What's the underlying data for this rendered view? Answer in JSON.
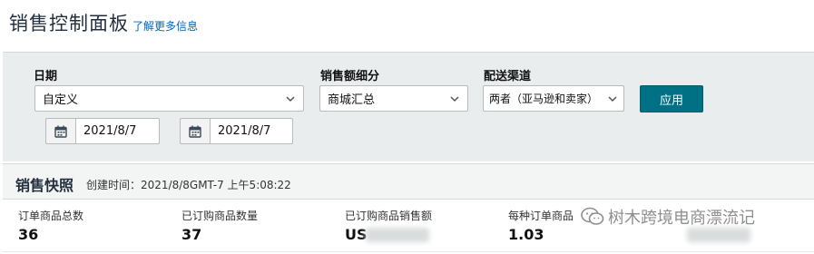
{
  "header": {
    "title": "销售控制面板",
    "info_link": "了解更多信息"
  },
  "filters": {
    "date_label": "日期",
    "date_select_value": "自定义",
    "start_date": "2021/8/7",
    "end_date": "2021/8/7",
    "breakdown_label": "销售额细分",
    "breakdown_value": "商城汇总",
    "channel_label": "配送渠道",
    "channel_value": "两者（亚马逊和卖家）",
    "apply_label": "应用"
  },
  "snapshot": {
    "title": "销售快照",
    "created_time": "创建时间：2021/8/8GMT-7 上午5:08:22",
    "metrics": [
      {
        "label": "订单商品总数",
        "value": "36"
      },
      {
        "label": "已订购商品数量",
        "value": "37"
      },
      {
        "label": "已订购商品销售额",
        "value": "US"
      },
      {
        "label": "每种订单商品",
        "value": "1.03"
      },
      {
        "label": "",
        "value": ""
      }
    ]
  },
  "watermark": {
    "text": "树木跨境电商漂流记"
  },
  "icons": {
    "calendar": "calendar-icon",
    "chevron": "chevron-down-icon",
    "watermark": "wechat-icon"
  },
  "colors": {
    "primary_button": "#007185",
    "link": "#0066c0",
    "panel_bg": "#e9edee"
  }
}
